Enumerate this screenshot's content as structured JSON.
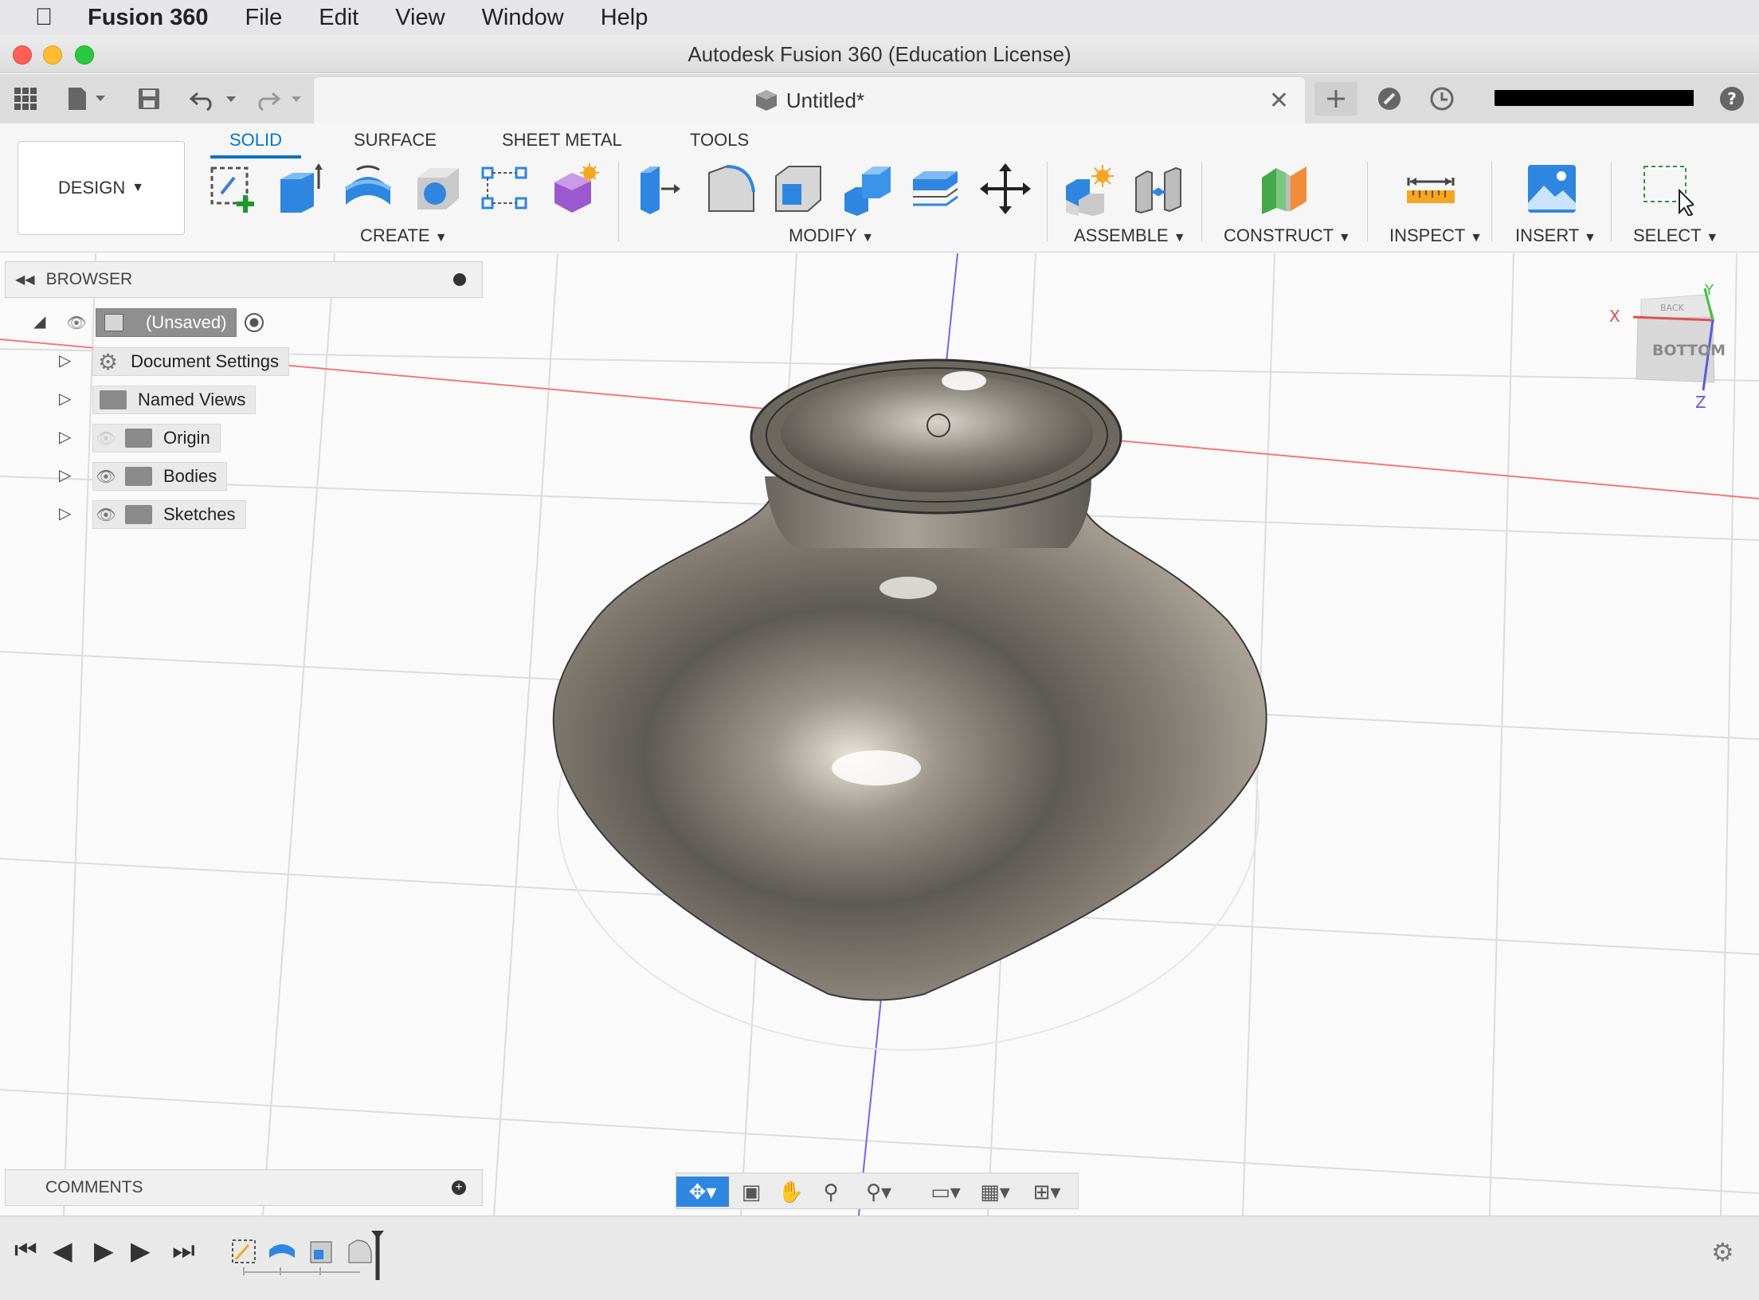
{
  "menubar": {
    "app": "Fusion 360",
    "items": [
      "File",
      "Edit",
      "View",
      "Window",
      "Help"
    ]
  },
  "window": {
    "title": "Autodesk Fusion 360 (Education License)"
  },
  "tabbar": {
    "doc_title": "Untitled*"
  },
  "ribbon": {
    "workspace": "DESIGN",
    "tabs": [
      "SOLID",
      "SURFACE",
      "SHEET METAL",
      "TOOLS"
    ],
    "groups": {
      "create": "CREATE",
      "modify": "MODIFY",
      "assemble": "ASSEMBLE",
      "construct": "CONSTRUCT",
      "inspect": "INSPECT",
      "insert": "INSERT",
      "select": "SELECT"
    }
  },
  "browser": {
    "title": "BROWSER",
    "root": "(Unsaved)",
    "items": [
      "Document Settings",
      "Named Views",
      "Origin",
      "Bodies",
      "Sketches"
    ]
  },
  "comments": {
    "title": "COMMENTS"
  },
  "viewcube": {
    "face": "BOTTOM",
    "top_face": "BACK",
    "axis_x": "X",
    "axis_y": "Y",
    "axis_z": "Z"
  },
  "colors": {
    "accent": "#0a74c9",
    "body": "#8a847a",
    "x_axis": "#e05050",
    "z_axis": "#5a5ae0"
  }
}
